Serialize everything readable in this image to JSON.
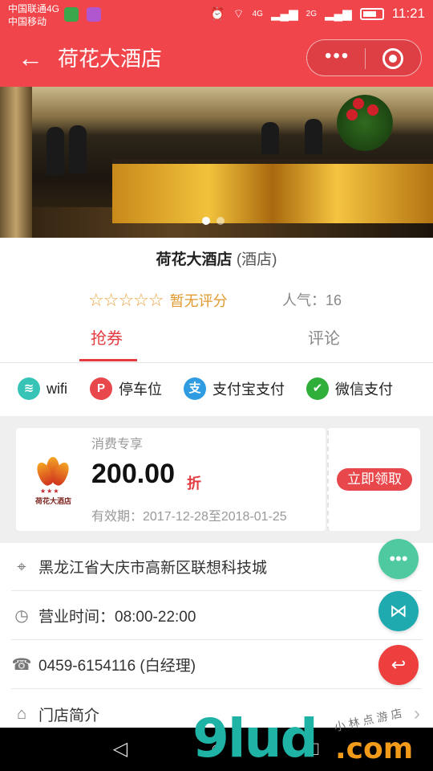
{
  "status_bar": {
    "carrier_1": "中国联通4G",
    "carrier_2": "中国移动",
    "net_4g": "4G",
    "net_2g": "2G",
    "time": "11:21"
  },
  "nav": {
    "back_icon": "arrow-left-icon",
    "title": "荷花大酒店",
    "more_icon": "more-dots-icon",
    "close_icon": "target-circle-icon"
  },
  "hero": {
    "slide_count": 2,
    "active_slide": 1
  },
  "hotel": {
    "name": "荷花大酒店",
    "category": "(酒店)",
    "stars": "☆☆☆☆☆",
    "rating_text": "暂无评分",
    "popularity": "人气：16"
  },
  "tabs": {
    "coupon": "抢券",
    "review": "评论"
  },
  "amenities": [
    {
      "label": "wifi",
      "icon": "wifi-icon",
      "color": "#37c4b6"
    },
    {
      "label": "停车位",
      "icon": "parking-icon",
      "color": "#e8474b"
    },
    {
      "label": "支付宝支付",
      "icon": "alipay-icon",
      "color": "#2f9be0"
    },
    {
      "label": "微信支付",
      "icon": "wechat-pay-icon",
      "color": "#2fae3a"
    }
  ],
  "coupon": {
    "label": "消费专享",
    "amount": "200.00",
    "unit": "折",
    "validity": "有效期：2017-12-28至2018-01-25",
    "claim": "立即领取",
    "logo_name": "荷花大酒店",
    "logo_stars": "★★★"
  },
  "info": {
    "address": "黑龙江省大庆市高新区联想科技城",
    "hours": "营业时间：08:00-22:00",
    "phone": "0459-6154116 (白经理)",
    "intro": "门店简介"
  },
  "fabs": [
    {
      "icon": "chat-bubble-icon",
      "color": "#4ec9a0"
    },
    {
      "icon": "share-icon",
      "color": "#1faab0"
    },
    {
      "icon": "return-arrow-icon",
      "color": "#ee3f3f"
    }
  ],
  "watermark": {
    "text": "9lud",
    "domain": ".com",
    "sub": "小林点游店"
  },
  "colors": {
    "brand": "#f0454a",
    "accent": "#e33b3f",
    "rating": "#e8a33d"
  }
}
